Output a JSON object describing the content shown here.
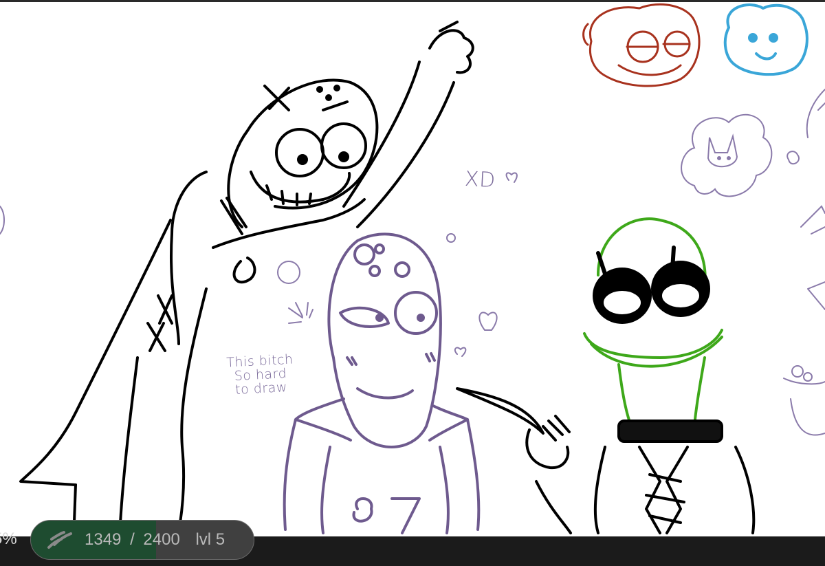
{
  "canvas": {
    "annotation_xd": "XD",
    "note_lines": [
      "This bitch",
      "So hard",
      "to draw"
    ]
  },
  "status_bar": {
    "zoom": "5%",
    "progress": {
      "current": "1349",
      "separator": "/",
      "total": "2400",
      "level": "lvl 5",
      "fraction": 0.562,
      "icon": "brush-strokes-icon"
    }
  },
  "colors": {
    "ink_black": "#000000",
    "ink_purple": "#6e5a8e",
    "ink_light_purple": "#8a7aaa",
    "ink_green": "#3ea81a",
    "ink_red": "#a8321e",
    "ink_blue": "#3aa6d8",
    "progress_fill": "#1e4c30",
    "status_bg": "#1b1b1b"
  }
}
